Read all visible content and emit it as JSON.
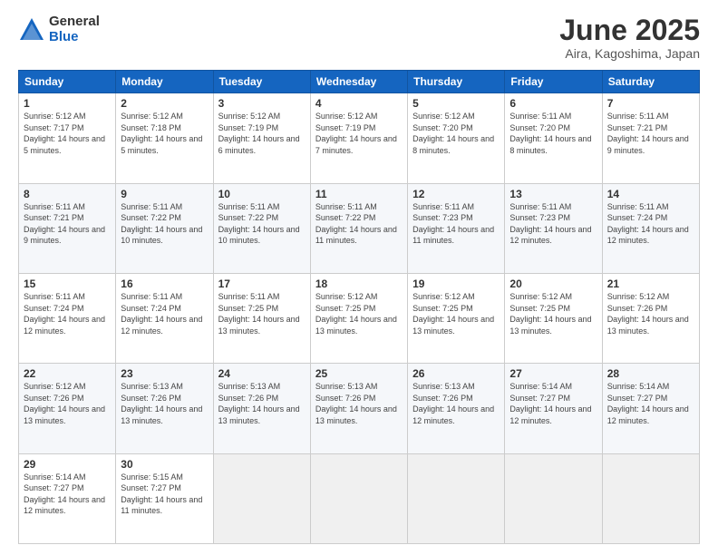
{
  "logo": {
    "general": "General",
    "blue": "Blue"
  },
  "header": {
    "month": "June 2025",
    "location": "Aira, Kagoshima, Japan"
  },
  "weekdays": [
    "Sunday",
    "Monday",
    "Tuesday",
    "Wednesday",
    "Thursday",
    "Friday",
    "Saturday"
  ],
  "weeks": [
    [
      {
        "day": "1",
        "sunrise": "5:12 AM",
        "sunset": "7:17 PM",
        "daylight": "14 hours and 5 minutes."
      },
      {
        "day": "2",
        "sunrise": "5:12 AM",
        "sunset": "7:18 PM",
        "daylight": "14 hours and 5 minutes."
      },
      {
        "day": "3",
        "sunrise": "5:12 AM",
        "sunset": "7:19 PM",
        "daylight": "14 hours and 6 minutes."
      },
      {
        "day": "4",
        "sunrise": "5:12 AM",
        "sunset": "7:19 PM",
        "daylight": "14 hours and 7 minutes."
      },
      {
        "day": "5",
        "sunrise": "5:12 AM",
        "sunset": "7:20 PM",
        "daylight": "14 hours and 8 minutes."
      },
      {
        "day": "6",
        "sunrise": "5:11 AM",
        "sunset": "7:20 PM",
        "daylight": "14 hours and 8 minutes."
      },
      {
        "day": "7",
        "sunrise": "5:11 AM",
        "sunset": "7:21 PM",
        "daylight": "14 hours and 9 minutes."
      }
    ],
    [
      {
        "day": "8",
        "sunrise": "5:11 AM",
        "sunset": "7:21 PM",
        "daylight": "14 hours and 9 minutes."
      },
      {
        "day": "9",
        "sunrise": "5:11 AM",
        "sunset": "7:22 PM",
        "daylight": "14 hours and 10 minutes."
      },
      {
        "day": "10",
        "sunrise": "5:11 AM",
        "sunset": "7:22 PM",
        "daylight": "14 hours and 10 minutes."
      },
      {
        "day": "11",
        "sunrise": "5:11 AM",
        "sunset": "7:22 PM",
        "daylight": "14 hours and 11 minutes."
      },
      {
        "day": "12",
        "sunrise": "5:11 AM",
        "sunset": "7:23 PM",
        "daylight": "14 hours and 11 minutes."
      },
      {
        "day": "13",
        "sunrise": "5:11 AM",
        "sunset": "7:23 PM",
        "daylight": "14 hours and 12 minutes."
      },
      {
        "day": "14",
        "sunrise": "5:11 AM",
        "sunset": "7:24 PM",
        "daylight": "14 hours and 12 minutes."
      }
    ],
    [
      {
        "day": "15",
        "sunrise": "5:11 AM",
        "sunset": "7:24 PM",
        "daylight": "14 hours and 12 minutes."
      },
      {
        "day": "16",
        "sunrise": "5:11 AM",
        "sunset": "7:24 PM",
        "daylight": "14 hours and 12 minutes."
      },
      {
        "day": "17",
        "sunrise": "5:11 AM",
        "sunset": "7:25 PM",
        "daylight": "14 hours and 13 minutes."
      },
      {
        "day": "18",
        "sunrise": "5:12 AM",
        "sunset": "7:25 PM",
        "daylight": "14 hours and 13 minutes."
      },
      {
        "day": "19",
        "sunrise": "5:12 AM",
        "sunset": "7:25 PM",
        "daylight": "14 hours and 13 minutes."
      },
      {
        "day": "20",
        "sunrise": "5:12 AM",
        "sunset": "7:25 PM",
        "daylight": "14 hours and 13 minutes."
      },
      {
        "day": "21",
        "sunrise": "5:12 AM",
        "sunset": "7:26 PM",
        "daylight": "14 hours and 13 minutes."
      }
    ],
    [
      {
        "day": "22",
        "sunrise": "5:12 AM",
        "sunset": "7:26 PM",
        "daylight": "14 hours and 13 minutes."
      },
      {
        "day": "23",
        "sunrise": "5:13 AM",
        "sunset": "7:26 PM",
        "daylight": "14 hours and 13 minutes."
      },
      {
        "day": "24",
        "sunrise": "5:13 AM",
        "sunset": "7:26 PM",
        "daylight": "14 hours and 13 minutes."
      },
      {
        "day": "25",
        "sunrise": "5:13 AM",
        "sunset": "7:26 PM",
        "daylight": "14 hours and 13 minutes."
      },
      {
        "day": "26",
        "sunrise": "5:13 AM",
        "sunset": "7:26 PM",
        "daylight": "14 hours and 12 minutes."
      },
      {
        "day": "27",
        "sunrise": "5:14 AM",
        "sunset": "7:27 PM",
        "daylight": "14 hours and 12 minutes."
      },
      {
        "day": "28",
        "sunrise": "5:14 AM",
        "sunset": "7:27 PM",
        "daylight": "14 hours and 12 minutes."
      }
    ],
    [
      {
        "day": "29",
        "sunrise": "5:14 AM",
        "sunset": "7:27 PM",
        "daylight": "14 hours and 12 minutes."
      },
      {
        "day": "30",
        "sunrise": "5:15 AM",
        "sunset": "7:27 PM",
        "daylight": "14 hours and 11 minutes."
      },
      null,
      null,
      null,
      null,
      null
    ]
  ]
}
